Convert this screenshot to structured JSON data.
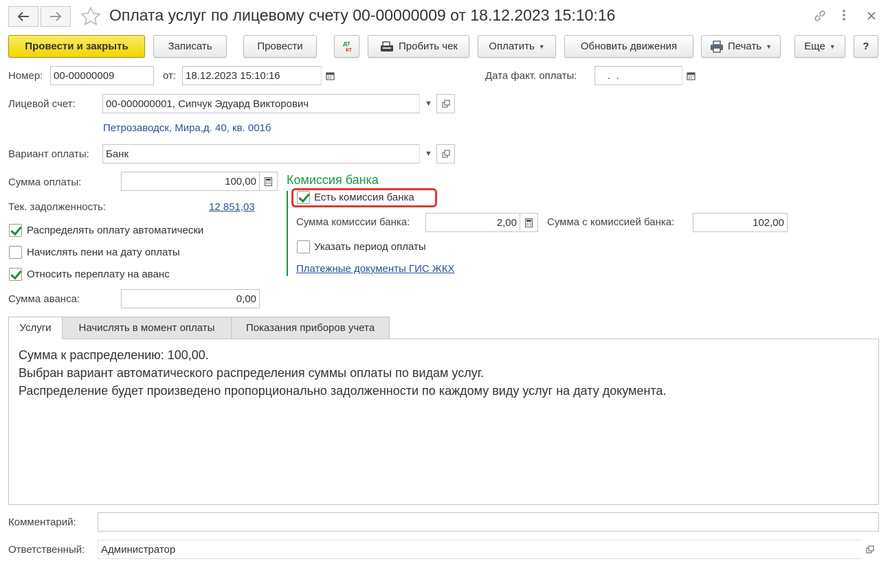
{
  "window": {
    "title": "Оплата услуг по лицевому счету 00-00000009 от 18.12.2023 15:10:16",
    "nav_back_icon": "arrow-left-icon",
    "nav_forward_icon": "arrow-right-icon",
    "favorite_icon": "star-icon",
    "link_icon": "link-icon",
    "more_icon": "kebab-icon",
    "close_icon": "close-icon"
  },
  "toolbar": {
    "post_close": "Провести и закрыть",
    "save": "Записать",
    "post": "Провести",
    "dtkt_top": "дт",
    "dtkt_bottom": "кт",
    "print_receipt": "Пробить чек",
    "pay": "Оплатить",
    "update_movements": "Обновить движения",
    "print": "Печать",
    "more": "Еще",
    "help": "?"
  },
  "form": {
    "number_label": "Номер:",
    "number_value": "00-00000009",
    "from_label": "от:",
    "date_value": "18.12.2023 15:10:16",
    "fact_date_label": "Дата факт. оплаты:",
    "fact_date_value": " .  .",
    "account_label": "Лицевой счет:",
    "account_value": "00-000000001, Сипчук Эдуард Викторович",
    "address": "Петрозаводск, Мира,д. 40, кв. 001б",
    "payment_variant_label": "Вариант оплаты:",
    "payment_variant_value": "Банк",
    "amount_label": "Сумма оплаты:",
    "amount_value": "100,00",
    "debt_label": "Тек. задолженность:",
    "debt_value": "12 851,03",
    "cb_distribute": "Распределять оплату автоматически",
    "cb_distribute_checked": true,
    "cb_penalty": "Начислять пени на дату оплаты",
    "cb_penalty_checked": false,
    "cb_overpay": "Относить переплату на аванс",
    "cb_overpay_checked": true,
    "advance_label": "Сумма аванса:",
    "advance_value": "0,00"
  },
  "commission": {
    "group_title": "Комиссия банка",
    "has_commission": "Есть комиссия банка",
    "has_commission_checked": true,
    "commission_label": "Сумма комиссии банка:",
    "commission_value": "2,00",
    "total_label": "Сумма с комиссией банка:",
    "total_value": "102,00",
    "period_label": "Указать период оплаты",
    "period_checked": false,
    "gis_link": "Платежные документы ГИС ЖКХ",
    "group_color": "#1a9641",
    "highlight_color": "#e03a2e"
  },
  "tabs": [
    {
      "label": "Услуги",
      "active": true
    },
    {
      "label": "Начислять в момент оплаты",
      "active": false
    },
    {
      "label": "Показания приборов учета",
      "active": false
    }
  ],
  "services_panel": {
    "line1": "Сумма к распределению: 100,00.",
    "line2": "Выбран вариант автоматического распределения суммы оплаты по видам услуг.",
    "line3": "Распределение будет произведено пропорционально задолженности по каждому виду услуг на дату документа."
  },
  "footer": {
    "comment_label": "Комментарий:",
    "comment_value": "",
    "responsible_label": "Ответственный:",
    "responsible_value": "Администратор"
  }
}
